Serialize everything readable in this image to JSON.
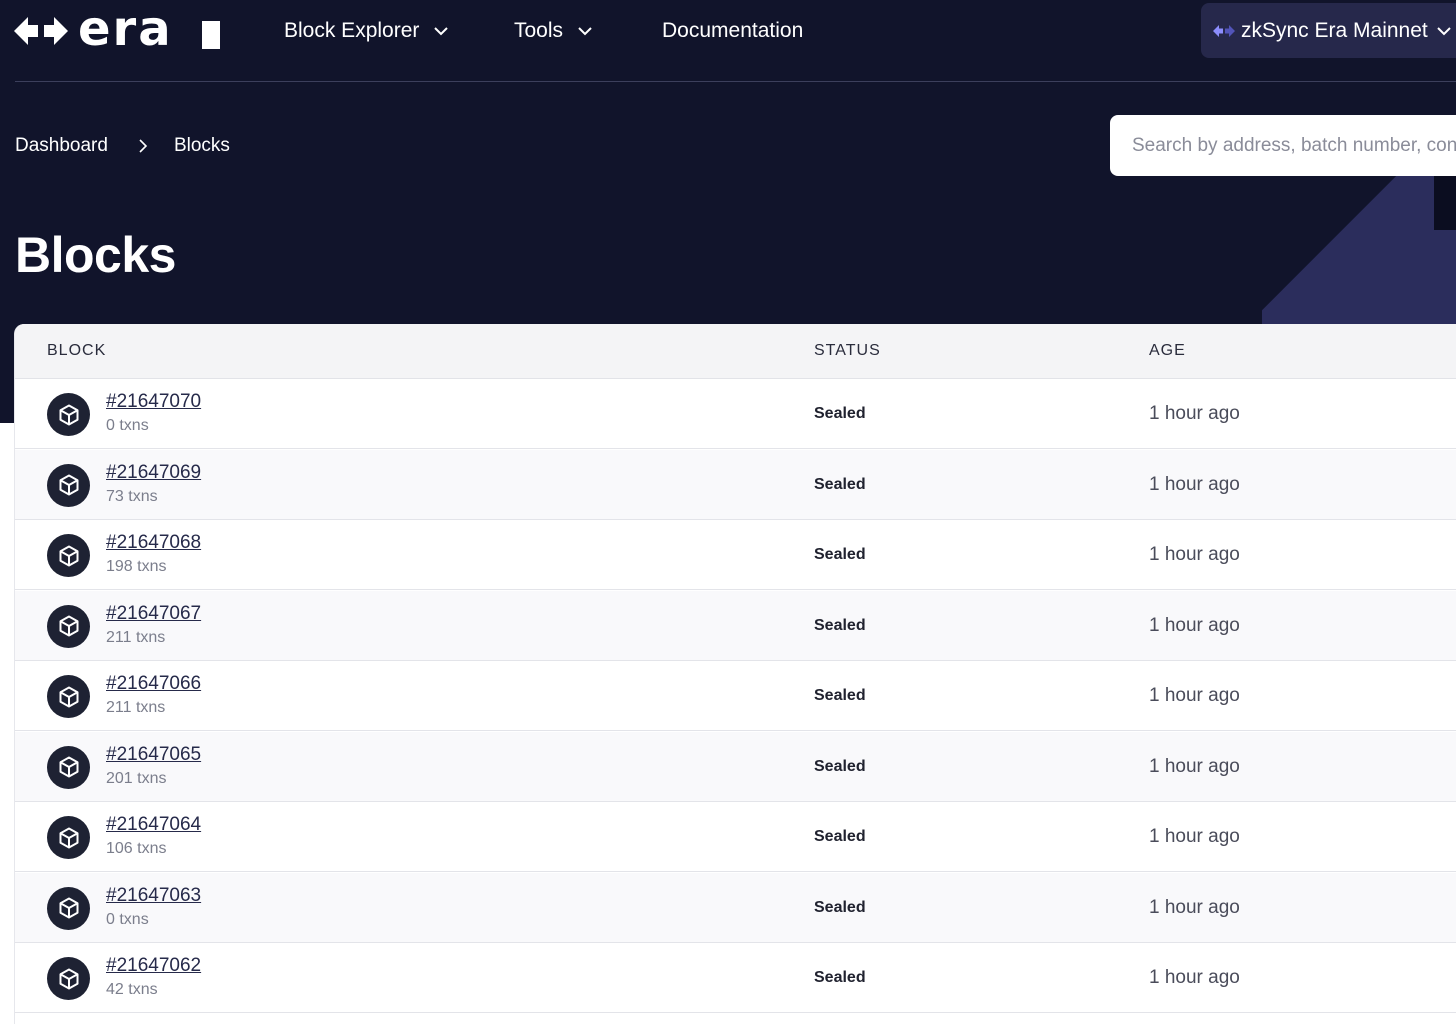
{
  "nav": {
    "logo_text": "era",
    "items": [
      {
        "label": "Block Explorer",
        "has_dropdown": true
      },
      {
        "label": "Tools",
        "has_dropdown": true
      },
      {
        "label": "Documentation",
        "has_dropdown": false
      }
    ],
    "network": {
      "label": "zkSync Era Mainnet",
      "icon": "zksync-arrows-icon"
    }
  },
  "breadcrumb": {
    "items": [
      "Dashboard",
      "Blocks"
    ]
  },
  "search": {
    "placeholder": "Search by address, batch number, contract name"
  },
  "page_title": "Blocks",
  "table": {
    "headers": [
      "BLOCK",
      "STATUS",
      "AGE"
    ],
    "rows": [
      {
        "block": "#21647070",
        "txns": "0 txns",
        "status": "Sealed",
        "age": "1 hour ago"
      },
      {
        "block": "#21647069",
        "txns": "73 txns",
        "status": "Sealed",
        "age": "1 hour ago"
      },
      {
        "block": "#21647068",
        "txns": "198 txns",
        "status": "Sealed",
        "age": "1 hour ago"
      },
      {
        "block": "#21647067",
        "txns": "211 txns",
        "status": "Sealed",
        "age": "1 hour ago"
      },
      {
        "block": "#21647066",
        "txns": "211 txns",
        "status": "Sealed",
        "age": "1 hour ago"
      },
      {
        "block": "#21647065",
        "txns": "201 txns",
        "status": "Sealed",
        "age": "1 hour ago"
      },
      {
        "block": "#21647064",
        "txns": "106 txns",
        "status": "Sealed",
        "age": "1 hour ago"
      },
      {
        "block": "#21647063",
        "txns": "0 txns",
        "status": "Sealed",
        "age": "1 hour ago"
      },
      {
        "block": "#21647062",
        "txns": "42 txns",
        "status": "Sealed",
        "age": "1 hour ago"
      }
    ],
    "row_icon": "cube-icon"
  },
  "colors": {
    "header_bg": "#11142b",
    "network_bg": "#26284b",
    "accent": "#8c8dfc"
  }
}
